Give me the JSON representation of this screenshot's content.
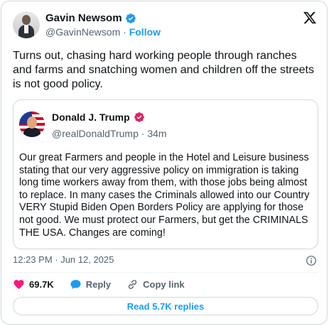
{
  "author": {
    "name": "Gavin Newsom",
    "handle": "@GavinNewsom",
    "separator": " · ",
    "follow_label": "Follow"
  },
  "tweet": {
    "text": "Turns out, chasing hard working people through ranches and farms and snatching women and children off the streets is not good policy."
  },
  "quoted": {
    "name": "Donald J. Trump",
    "handle": "@realDonaldTrump",
    "separator": " · ",
    "time": "34m",
    "lines": [
      "Our great Farmers and people in the Hotel and Leisure business",
      "stating that our very aggressive policy on immigration is taking",
      "long time workers away from them, with those jobs being almost",
      "to replace. In many cases the Criminals allowed into our Country",
      "VERY Stupid Biden Open Borders Policy are applying for those",
      "not good. We must protect our Farmers, but get the CRIMINALS",
      "THE USA. Changes are coming!"
    ]
  },
  "timestamp": "12:23 PM · Jun 12, 2025",
  "actions": {
    "likes": "69.7K",
    "reply": "Reply",
    "copy_link": "Copy link"
  },
  "read_replies": "Read 5.7K replies",
  "icons": {
    "verified": "verified-badge-icon",
    "quoted_verified": "verified-badge-red-icon",
    "x_logo": "x-logo-icon",
    "info": "info-icon",
    "heart": "heart-icon",
    "reply": "reply-bubble-icon",
    "link": "link-icon"
  },
  "colors": {
    "accent": "#1d9bf0",
    "like": "#f91880",
    "muted": "#536471",
    "border": "#cfd9de"
  }
}
